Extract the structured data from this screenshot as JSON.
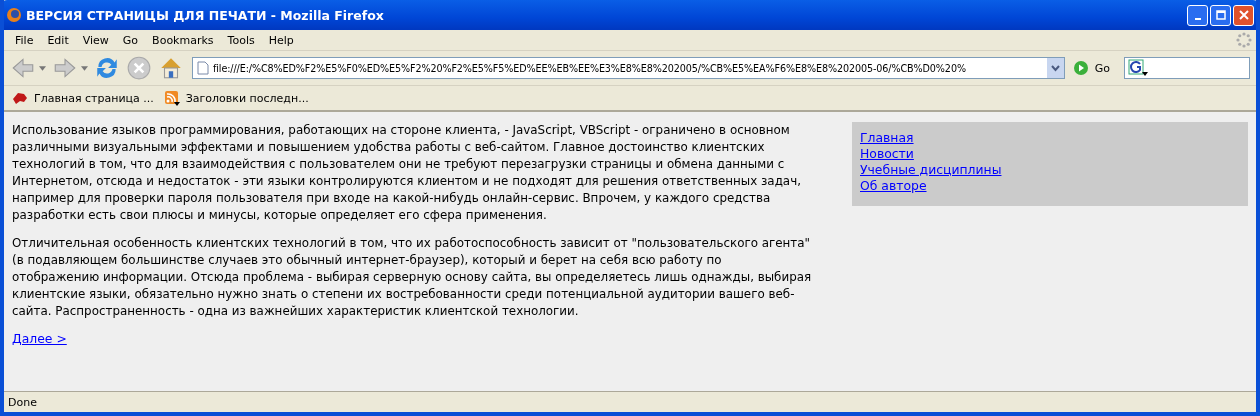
{
  "window": {
    "title": "ВЕРСИЯ СТРАНИЦЫ ДЛЯ ПЕЧАТИ - Mozilla Firefox"
  },
  "menu": [
    "File",
    "Edit",
    "View",
    "Go",
    "Bookmarks",
    "Tools",
    "Help"
  ],
  "address": {
    "value": "file:///E:/%C8%ED%F2%E5%F0%ED%E5%F2%20%F2%E5%F5%ED%EE%EB%EE%E3%E8%E8%202005/%CB%E5%EA%F6%E8%E8%202005-06/%CB%D0%20%",
    "go": "Go"
  },
  "bookmarks": [
    {
      "label": "Главная страница ...",
      "kind": "site"
    },
    {
      "label": "Заголовки последн...",
      "kind": "feed"
    }
  ],
  "paragraphs": [
    "Использование языков программирования, работающих на стороне клиента, - JavaScript, VBScript - ограничено в основном различными визуальными эффектами и повышением удобства работы с веб-сайтом. Главное достоинство клиентских технологий в том, что для взаимодействия с пользователем они не требуют перезагрузки страницы и обмена данными с Интернетом, отсюда и недостаток - эти языки контролируются клиентом и не подходят для решения ответственных задач, например для проверки пароля пользователя при входе на какой-нибудь онлайн-сервис. Впрочем, у каждого средства разработки есть свои плюсы и минусы, которые определяет его сфера применения.",
    "Отличительная особенность клиентских технологий в том, что их работоспособность зависит от \"пользовательского агента\" (в подавляющем большинстве случаев это обычный интернет-браузер), который и берет на себя всю работу по отображению информации. Отсюда проблема - выбирая серверную основу сайта, вы определяетесь лишь однажды, выбирая клиентские языки, обязательно нужно знать о степени их востребованности среди потенциальной аудитории вашего веб-сайта. Распространенность - одна из важнейших характеристик клиентской технологии."
  ],
  "more_link": "Далее >",
  "nav_links": [
    "Главная",
    "Новости",
    "Учебные дисциплины",
    "Об авторе"
  ],
  "status_bar": "Done"
}
